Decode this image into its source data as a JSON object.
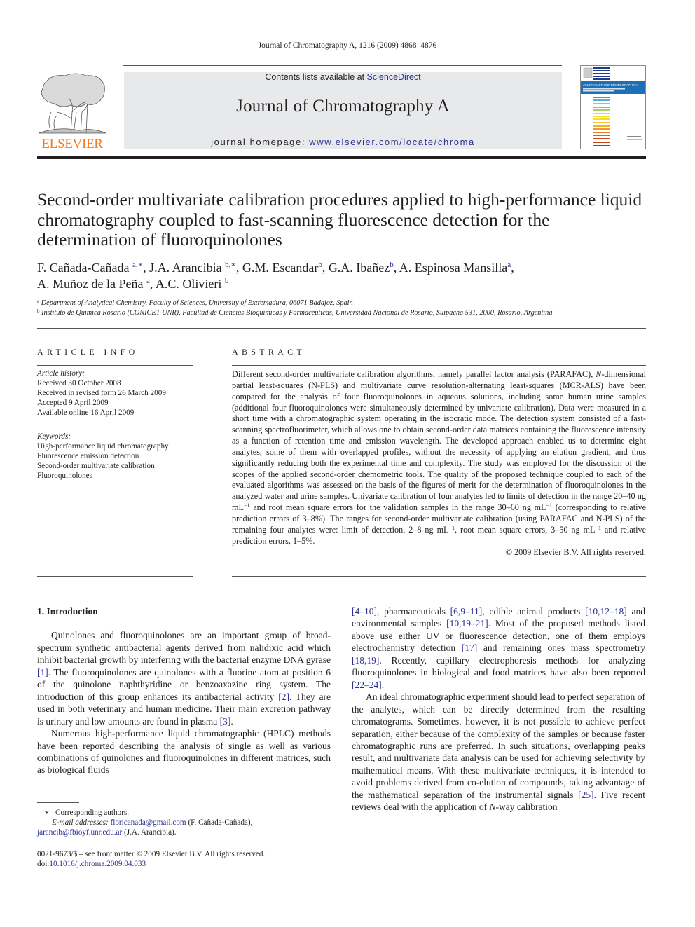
{
  "running_head": "Journal of Chromatography A, 1216 (2009) 4868–4876",
  "masthead": {
    "contents_prefix": "Contents lists available at ",
    "contents_link": "ScienceDirect",
    "journal_title": "Journal of Chromatography A",
    "homepage_prefix": "journal homepage: ",
    "homepage_link": "www.elsevier.com/locate/chroma",
    "publisher_logo_text": "ELSEVIER",
    "cover_title": "JOURNAL OF CHROMATOGRAPHY A",
    "colors": {
      "elsevier_orange": "#f47920",
      "link_blue": "#2e3192",
      "masthead_gray": "#e8e9ea"
    }
  },
  "article": {
    "title": "Second-order multivariate calibration procedures applied to high-performance liquid chromatography coupled to fast-scanning fluorescence detection for the determination of fluoroquinolones",
    "authors": [
      {
        "name": "F. Cañada-Cañada",
        "sup": "a,∗"
      },
      {
        "name": "J.A. Arancibia",
        "sup": "b,∗"
      },
      {
        "name": "G.M. Escandar",
        "sup": "b"
      },
      {
        "name": "G.A. Ibañez",
        "sup": "b"
      },
      {
        "name": "A. Espinosa Mansilla",
        "sup": "a"
      },
      {
        "name": "A. Muñoz de la Peña",
        "sup": "a"
      },
      {
        "name": "A.C. Olivieri",
        "sup": "b"
      }
    ],
    "affiliations": [
      {
        "mark": "a",
        "text": "Department of Analytical Chemistry, Faculty of Sciences, University of Extremadura, 06071 Badajoz, Spain"
      },
      {
        "mark": "b",
        "text": "Instituto de Química Rosario (CONICET-UNR), Facultad de Ciencias Bioquímicas y Farmacéuticas, Universidad Nacional de Rosario, Suipacha 531, 2000, Rosario, Argentina"
      }
    ]
  },
  "article_info": {
    "label": "ARTICLE INFO",
    "history_label": "Article history:",
    "history": [
      "Received 30 October 2008",
      "Received in revised form 26 March 2009",
      "Accepted 9 April 2009",
      "Available online 16 April 2009"
    ],
    "keywords_label": "Keywords:",
    "keywords": [
      "High-performance liquid chromatography",
      "Fluorescence emission detection",
      "Second-order multivariate calibration",
      "Fluoroquinolones"
    ]
  },
  "abstract": {
    "label": "ABSTRACT",
    "parts": {
      "p1": "Different second-order multivariate calibration algorithms, namely parallel factor analysis (PARAFAC), ",
      "n": "N",
      "p2": "-dimensional partial least-squares (N-PLS) and multivariate curve resolution-alternating least-squares (MCR-ALS) have been compared for the analysis of four fluoroquinolones in aqueous solutions, including some human urine samples (additional four fluoroquinolones were simultaneously determined by univariate calibration). Data were measured in a short time with a chromatographic system operating in the isocratic mode. The detection system consisted of a fast-scanning spectrofluorimeter, which allows one to obtain second-order data matrices containing the fluorescence intensity as a function of retention time and emission wavelength. The developed approach enabled us to determine eight analytes, some of them with overlapped profiles, without the necessity of applying an elution gradient, and thus significantly reducing both the experimental time and complexity. The study was employed for the discussion of the scopes of the applied second-order chemometric tools. The quality of the proposed technique coupled to each of the evaluated algorithms was assessed on the basis of the figures of merit for the determination of fluoroquinolones in the analyzed water and urine samples. Univariate calibration of four analytes led to limits of detection in the range 20–40 ng mL",
      "sup1": "−1",
      "p3": " and root mean square errors for the validation samples in the range 30–60 ng mL",
      "sup2": "−1",
      "p4": " (corresponding to relative prediction errors of 3–8%). The ranges for second-order multivariate calibration (using PARAFAC and N-PLS) of the remaining four analytes were: limit of detection, 2–8 ng mL",
      "sup3": "−1",
      "p5": ", root mean square errors, 3–50 ng mL",
      "sup4": "−1",
      "p6": " and relative prediction errors, 1–5%."
    },
    "copyright": "© 2009 Elsevier B.V. All rights reserved."
  },
  "introduction": {
    "heading": "1.  Introduction",
    "para1": {
      "t1": "Quinolones and fluoroquinolones are an important group of broad-spectrum synthetic antibacterial agents derived from nalidixic acid which inhibit bacterial growth by interfering with the bacterial enzyme DNA gyrase ",
      "r1": "[1]",
      "t2": ". The fluoroquinolones are quinolones with a fluorine atom at position 6 of the quinolone naphthyridine or benzoaxazine ring system. The introduction of this group enhances its antibacterial activity ",
      "r2": "[2]",
      "t3": ". They are used in both veterinary and human medicine. Their main excretion pathway is urinary and low amounts are found in plasma ",
      "r3": "[3]",
      "t4": "."
    },
    "para2": {
      "t1": "Numerous high-performance liquid chromatographic (HPLC) methods have been reported describing the analysis of single as well as various combinations of quinolones and fluoroquinolones in different matrices, such as biological fluids ",
      "r1": "[4–10]",
      "t2": ", pharmaceuticals ",
      "r2": "[6,9–11]",
      "t3": ", edible animal products ",
      "r3": "[10,12–18]",
      "t4": " and environmental samples ",
      "r4": "[10,19–21]",
      "t5": ". Most of the proposed methods listed above use either UV or fluorescence detection, one of them employs electrochemistry detection ",
      "r5": "[17]",
      "t6": " and remaining ones mass spectrometry ",
      "r6": "[18,19]",
      "t7": ". Recently, capillary electrophoresis methods for analyzing fluoroquinolones in biological and food matrices have also been reported ",
      "r7": "[22–24]",
      "t8": "."
    },
    "para3": {
      "t1": "An ideal chromatographic experiment should lead to perfect separation of the analytes, which can be directly determined from the resulting chromatograms. Sometimes, however, it is not possible to achieve perfect separation, either because of the complexity of the samples or because faster chromatographic runs are preferred. In such situations, overlapping peaks result, and multivariate data analysis can be used for achieving selectivity by mathematical means. With these multivariate techniques, it is intended to avoid problems derived from co-elution of compounds, taking advantage of the mathematical separation of the instrumental signals ",
      "r1": "[25]",
      "t2": ". Five recent reviews deal with the application of ",
      "n": "N",
      "t3": "-way calibration"
    }
  },
  "footnotes": {
    "star": "∗",
    "corresponding": "Corresponding authors.",
    "email_label": "E-mail addresses:",
    "email1": "floricanada@gmail.com",
    "email1_owner": " (F. Cañada-Cañada),",
    "email2": "jarancib@fbioyf.unr.edu.ar",
    "email2_owner": " (J.A. Arancibia)."
  },
  "footer": {
    "issn_line": "0021-9673/$ – see front matter © 2009 Elsevier B.V. All rights reserved.",
    "doi_prefix": "doi:",
    "doi": "10.1016/j.chroma.2009.04.033"
  }
}
